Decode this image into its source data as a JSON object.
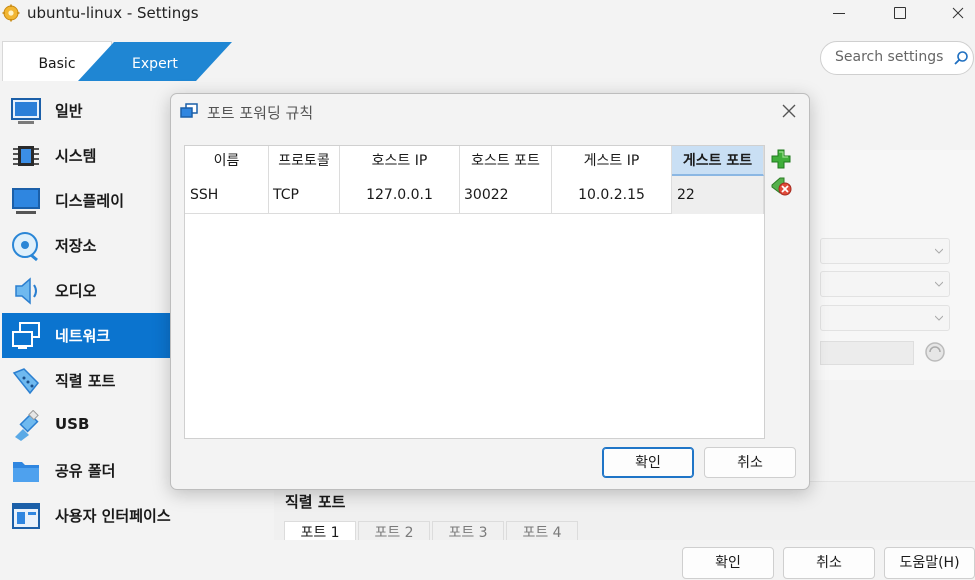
{
  "window": {
    "title": "ubuntu-linux - Settings"
  },
  "mode_tabs": {
    "basic": "Basic",
    "expert": "Expert"
  },
  "search": {
    "placeholder": "Search settings"
  },
  "sidebar": {
    "items": [
      {
        "label": "일반",
        "icon": "general-icon"
      },
      {
        "label": "시스템",
        "icon": "chip-icon"
      },
      {
        "label": "디스플레이",
        "icon": "monitor-icon"
      },
      {
        "label": "저장소",
        "icon": "disk-icon"
      },
      {
        "label": "오디오",
        "icon": "speaker-icon"
      },
      {
        "label": "네트워크",
        "icon": "network-icon",
        "active": true
      },
      {
        "label": "직렬 포트",
        "icon": "serial-port-icon"
      },
      {
        "label": "USB",
        "icon": "usb-icon"
      },
      {
        "label": "공유 폴더",
        "icon": "folder-icon"
      },
      {
        "label": "사용자 인터페이스",
        "icon": "ui-icon"
      }
    ]
  },
  "serial": {
    "title": "직렬 포트",
    "tabs": [
      "포트 1",
      "포트 2",
      "포트 3",
      "포트 4"
    ]
  },
  "buttons": {
    "ok": "확인",
    "cancel": "취소",
    "help": "도움말(H)"
  },
  "dialog": {
    "title": "포트 포워딩 규칙",
    "columns": [
      "이름",
      "프로토콜",
      "호스트 IP",
      "호스트 포트",
      "게스트 IP",
      "게스트 포트"
    ],
    "rows": [
      [
        "SSH",
        "TCP",
        "127.0.0.1",
        "30022",
        "10.0.2.15",
        "22"
      ]
    ],
    "ok": "확인",
    "cancel": "취소"
  },
  "colors": {
    "accent": "#1f86d3",
    "selection": "#0b74cf"
  }
}
